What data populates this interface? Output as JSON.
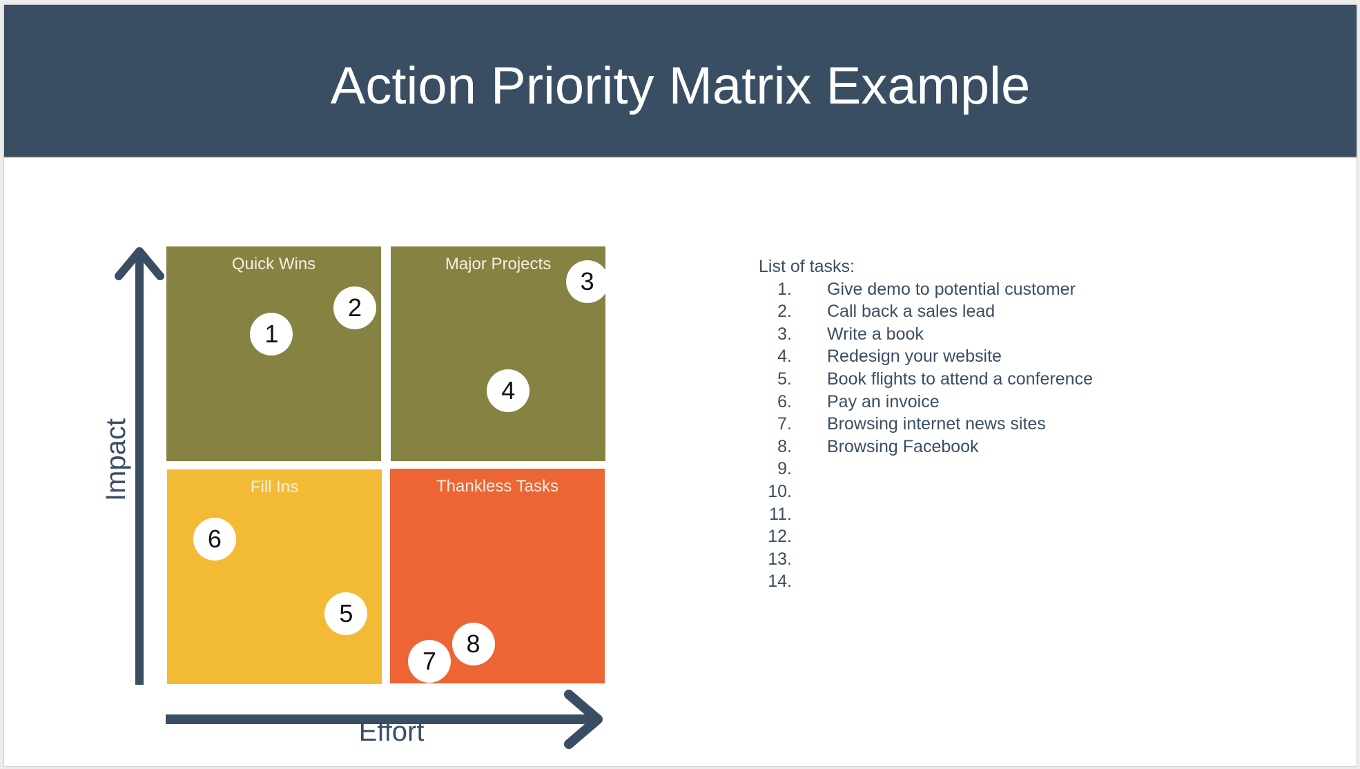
{
  "slide": {
    "title": "Action Priority Matrix Example",
    "colors": {
      "header_bg": "#3a4e63",
      "axis": "#3a4e63",
      "quick_wins": "#868342",
      "major_projects": "#868342",
      "fill_ins": "#f3bb35",
      "thankless_tasks": "#ed6535",
      "marker_bg": "#ffffff"
    }
  },
  "matrix": {
    "y_axis_label": "Impact",
    "x_axis_label": "Effort",
    "quadrants": [
      {
        "id": "quick-wins",
        "label": "Quick Wins",
        "impact": "high",
        "effort": "low"
      },
      {
        "id": "major-projects",
        "label": "Major Projects",
        "impact": "high",
        "effort": "high"
      },
      {
        "id": "fill-ins",
        "label": "Fill Ins",
        "impact": "low",
        "effort": "low"
      },
      {
        "id": "thankless-tasks",
        "label": "Thankless Tasks",
        "impact": "low",
        "effort": "high"
      }
    ],
    "markers": [
      {
        "label": "1",
        "quadrant": "quick-wins",
        "effort": 0.24,
        "impact": 0.8
      },
      {
        "label": "2",
        "quadrant": "quick-wins",
        "effort": 0.43,
        "impact": 0.86
      },
      {
        "label": "3",
        "quadrant": "major-projects",
        "effort": 0.96,
        "impact": 0.92
      },
      {
        "label": "4",
        "quadrant": "major-projects",
        "effort": 0.78,
        "impact": 0.67
      },
      {
        "label": "5",
        "quadrant": "fill-ins",
        "effort": 0.41,
        "impact": 0.16
      },
      {
        "label": "6",
        "quadrant": "fill-ins",
        "effort": 0.11,
        "impact": 0.33
      },
      {
        "label": "7",
        "quadrant": "thankless-tasks",
        "effort": 0.6,
        "impact": 0.05
      },
      {
        "label": "8",
        "quadrant": "thankless-tasks",
        "effort": 0.7,
        "impact": 0.09
      }
    ]
  },
  "tasks": {
    "heading": "List of tasks:",
    "items": [
      {
        "num": "1.",
        "text": "Give demo to potential customer"
      },
      {
        "num": "2.",
        "text": "Call back a sales lead"
      },
      {
        "num": "3.",
        "text": "Write a book"
      },
      {
        "num": "4.",
        "text": "Redesign your website"
      },
      {
        "num": "5.",
        "text": "Book flights to attend a conference"
      },
      {
        "num": "6.",
        "text": "Pay an invoice"
      },
      {
        "num": "7.",
        "text": "Browsing internet news sites"
      },
      {
        "num": "8.",
        "text": "Browsing Facebook"
      },
      {
        "num": "9.",
        "text": ""
      },
      {
        "num": "10.",
        "text": ""
      },
      {
        "num": "11.",
        "text": ""
      },
      {
        "num": "12.",
        "text": ""
      },
      {
        "num": "13.",
        "text": ""
      },
      {
        "num": "14.",
        "text": ""
      }
    ]
  }
}
